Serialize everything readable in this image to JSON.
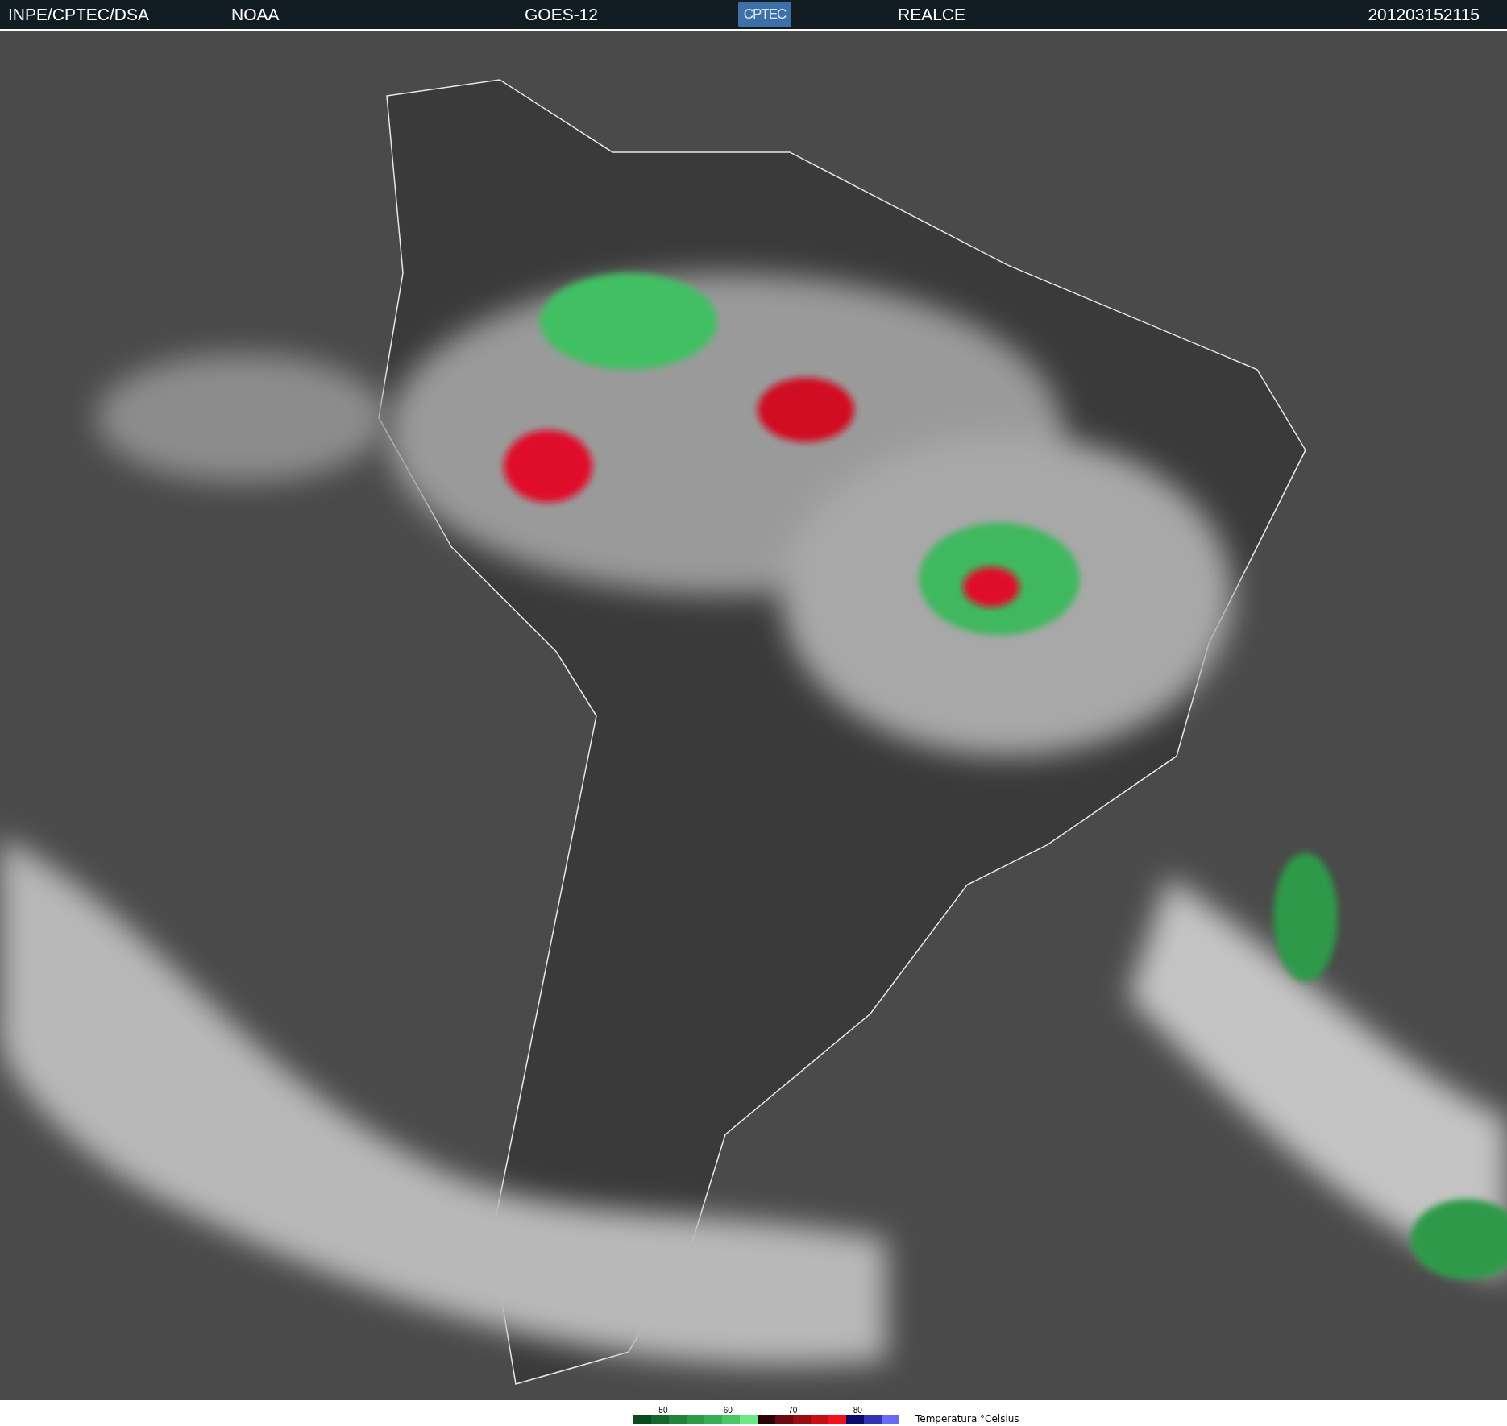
{
  "header": {
    "items": [
      "INPE/CPTEC/DSA",
      "NOAA",
      "GOES-12"
    ],
    "logo": "CPTEC",
    "items_after_logo": [
      "REALCE"
    ],
    "timestamp": "201203152115"
  },
  "legend": {
    "ticks": [
      "-50",
      "-60",
      "-70",
      "-80"
    ],
    "label": "Temperatura °Celsius",
    "swatches": [
      {
        "color": "#0b4a1c"
      },
      {
        "color": "#17662b"
      },
      {
        "color": "#218238"
      },
      {
        "color": "#2c9a47"
      },
      {
        "color": "#37ad56"
      },
      {
        "color": "#49c766"
      },
      {
        "color": "#6ee884"
      },
      {
        "color": "#2a0508"
      },
      {
        "color": "#6a0a0e"
      },
      {
        "color": "#9a0c12"
      },
      {
        "color": "#c80d15"
      },
      {
        "color": "#f5101c"
      },
      {
        "color": "#0a0a6e"
      },
      {
        "color": "#3232b4"
      },
      {
        "color": "#6a6af5"
      }
    ]
  }
}
